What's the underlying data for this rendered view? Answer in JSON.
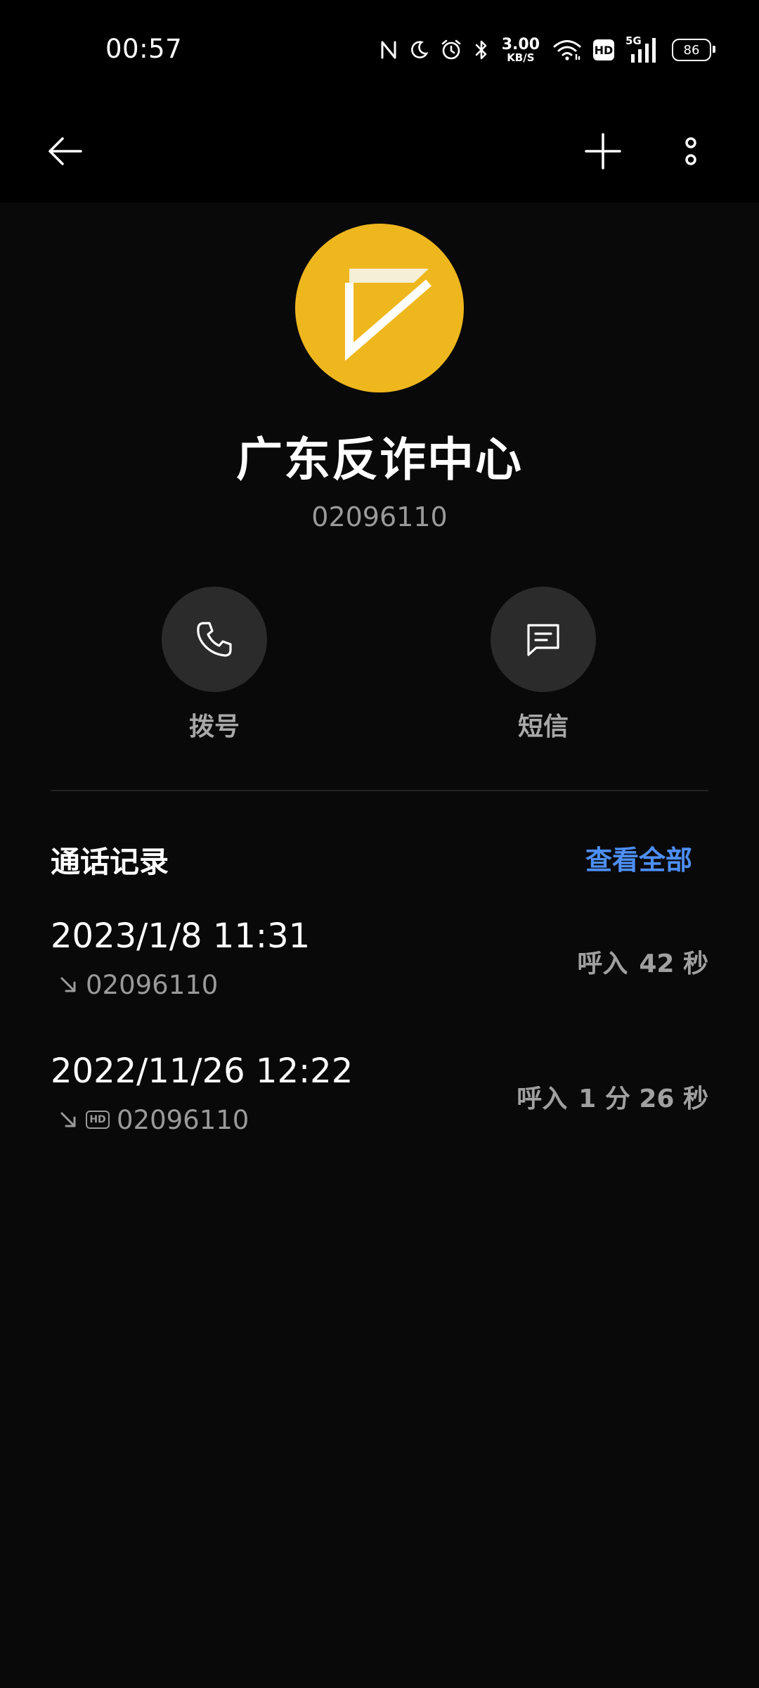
{
  "status_bar": {
    "time": "00:57",
    "net_speed_value": "3.00",
    "net_speed_unit": "KB/S",
    "hd_label": "HD",
    "network_type": "5G",
    "battery_level": "86"
  },
  "contact": {
    "name": "广东反诈中心",
    "number": "02096110",
    "avatar_color": "#EFB71E"
  },
  "actions": {
    "dial_label": "拨号",
    "sms_label": "短信"
  },
  "call_log": {
    "title": "通话记录",
    "view_all_label": "查看全部",
    "accent_color": "#4D8FF8",
    "entries": [
      {
        "datetime": "2023/1/8 11:31",
        "number": "02096110",
        "type": "呼入",
        "duration": "42 秒",
        "hd": false
      },
      {
        "datetime": "2022/11/26 12:22",
        "number": "02096110",
        "type": "呼入",
        "duration": "1 分 26 秒",
        "hd": true,
        "hd_label": "HD"
      }
    ]
  },
  "icons": {
    "back": "arrow-left-icon",
    "add": "plus-icon",
    "more": "more-vertical-icon",
    "dial": "phone-icon",
    "sms": "message-icon",
    "incoming": "incoming-call-arrow-icon"
  }
}
